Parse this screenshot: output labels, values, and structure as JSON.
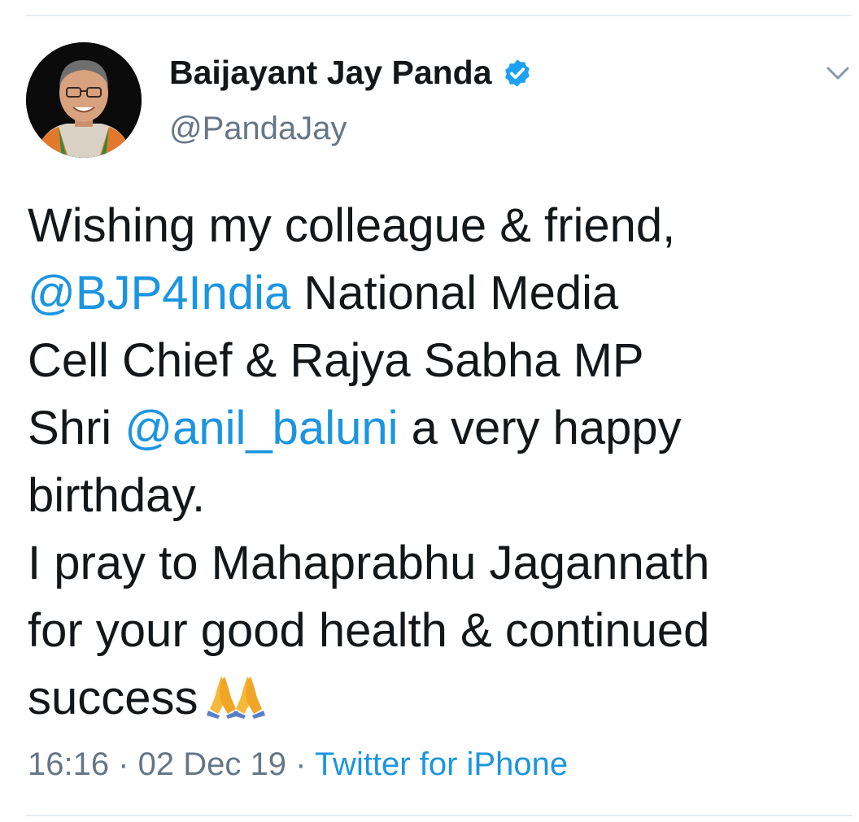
{
  "author": {
    "display_name": "Baijayant Jay Panda",
    "handle": "@PandaJay",
    "verified": true,
    "avatar_icon": "profile-photo"
  },
  "tweet": {
    "line1": "Wishing my colleague & friend,",
    "line2_mention": "@BJP4India",
    "line2_text": " National Media",
    "line3": "Cell Chief & Rajya Sabha MP",
    "line4_pre": "Shri ",
    "line4_mention": "@anil_baluni",
    "line4_post": " a very happy",
    "line5": "birthday.",
    "line6": "I pray to Mahaprabhu Jagannath",
    "line7": "for your good health & continued",
    "line8": "success",
    "emoji_icon": "folded-hands-emoji"
  },
  "meta": {
    "time": "16:16",
    "separator": " · ",
    "date": "02 Dec 19",
    "source": "Twitter for iPhone"
  },
  "colors": {
    "link": "#1b95e0",
    "text": "#14171a",
    "muted": "#657786",
    "verified": "#1da1f2"
  }
}
